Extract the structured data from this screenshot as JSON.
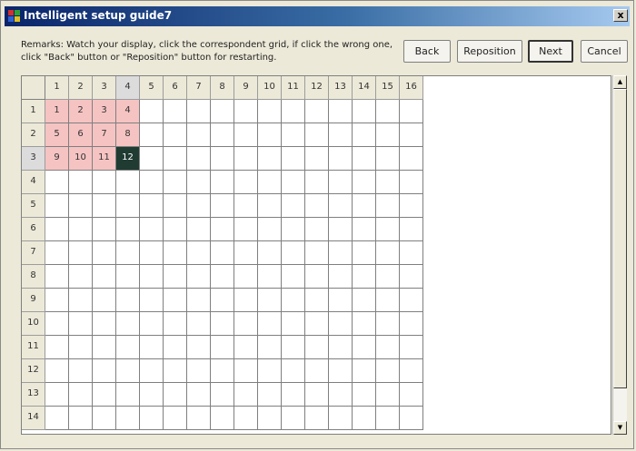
{
  "window": {
    "title": "Intelligent setup guide7",
    "close_label": "x"
  },
  "remarks": "Remarks: Watch your display, click the correspondent grid, if click the wrong one, click \"Back\" button or \"Reposition\" button for restarting.",
  "buttons": {
    "back": "Back",
    "reposition": "Reposition",
    "next": "Next",
    "cancel": "Cancel"
  },
  "grid": {
    "column_headers": [
      "1",
      "2",
      "3",
      "4",
      "5",
      "6",
      "7",
      "8",
      "9",
      "10",
      "11",
      "12",
      "13",
      "14",
      "15",
      "16"
    ],
    "row_headers": [
      "1",
      "2",
      "3",
      "4",
      "5",
      "6",
      "7",
      "8",
      "9",
      "10",
      "11",
      "12",
      "13",
      "14"
    ],
    "selected_column": "4",
    "selected_row": "3",
    "filled_cells": [
      {
        "row": 1,
        "col": 1,
        "label": "1",
        "state": "marked"
      },
      {
        "row": 1,
        "col": 2,
        "label": "2",
        "state": "marked"
      },
      {
        "row": 1,
        "col": 3,
        "label": "3",
        "state": "marked"
      },
      {
        "row": 1,
        "col": 4,
        "label": "4",
        "state": "marked"
      },
      {
        "row": 2,
        "col": 1,
        "label": "5",
        "state": "marked"
      },
      {
        "row": 2,
        "col": 2,
        "label": "6",
        "state": "marked"
      },
      {
        "row": 2,
        "col": 3,
        "label": "7",
        "state": "marked"
      },
      {
        "row": 2,
        "col": 4,
        "label": "8",
        "state": "marked"
      },
      {
        "row": 3,
        "col": 1,
        "label": "9",
        "state": "marked"
      },
      {
        "row": 3,
        "col": 2,
        "label": "10",
        "state": "marked"
      },
      {
        "row": 3,
        "col": 3,
        "label": "11",
        "state": "marked"
      },
      {
        "row": 3,
        "col": 4,
        "label": "12",
        "state": "current"
      }
    ]
  },
  "colors": {
    "marked": "#f6c3c3",
    "current": "#1f3b32",
    "title_gradient_start": "#0a246a"
  },
  "icons": {
    "app": "app-icon",
    "scroll_up": "arrow-up-icon",
    "scroll_down": "arrow-down-icon"
  }
}
